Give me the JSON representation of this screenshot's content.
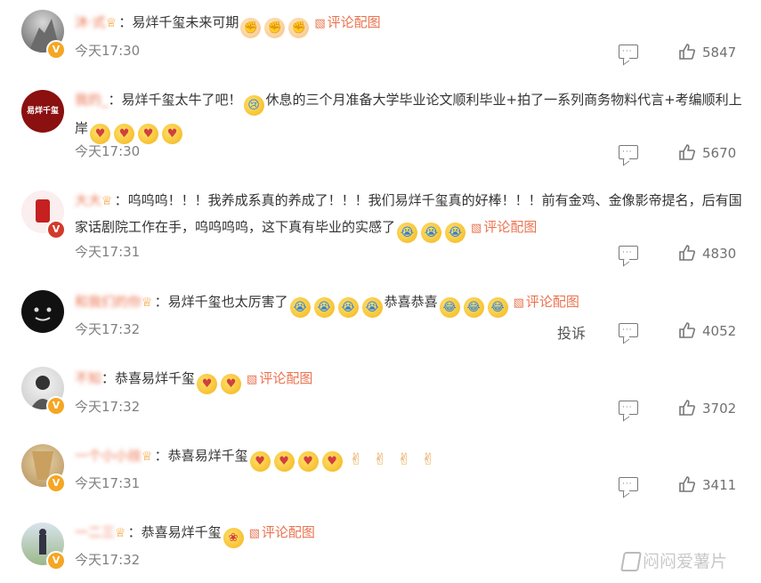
{
  "comments": [
    {
      "username": "沐·式",
      "badge": "♕",
      "content_parts": [
        {
          "type": "text",
          "value": "：易烊千玺未来可期"
        },
        {
          "type": "emoji",
          "name": "fist-emoji"
        },
        {
          "type": "emoji",
          "name": "fist-emoji"
        },
        {
          "type": "emoji",
          "name": "fist-emoji"
        }
      ],
      "link_label": "评论配图",
      "time": "今天17:30",
      "likes": "5847"
    },
    {
      "username": "我的_",
      "content_parts": [
        {
          "type": "text",
          "value": "：易烊千玺太牛了吧！"
        },
        {
          "type": "emoji",
          "name": "cry-emoji"
        },
        {
          "type": "text",
          "value": "休息的三个月准备大学毕业论文顺利毕业+拍了一系列商务物料代言+考编顺利上岸"
        },
        {
          "type": "emoji",
          "name": "love-emoji"
        },
        {
          "type": "emoji",
          "name": "love-emoji"
        },
        {
          "type": "emoji",
          "name": "love-emoji"
        },
        {
          "type": "emoji",
          "name": "love-emoji"
        }
      ],
      "avatar_text_top": "易烊千玺",
      "time": "今天17:30",
      "likes": "5670"
    },
    {
      "username": "大大",
      "badge": "♕",
      "content_parts": [
        {
          "type": "text",
          "value": "：呜呜呜！！！我养成系真的养成了！！！我们易烊千玺真的好棒！！！前有金鸡、金像影帝提名，后有国家话剧院工作在手，呜呜呜呜，这下真有毕业的实感了"
        },
        {
          "type": "emoji",
          "name": "cry-emoji"
        },
        {
          "type": "emoji",
          "name": "cry-emoji"
        },
        {
          "type": "emoji",
          "name": "cry-emoji"
        }
      ],
      "link_label": "评论配图",
      "time": "今天17:31",
      "likes": "4830"
    },
    {
      "username": "和我们的你",
      "badge": "♕",
      "content_parts": [
        {
          "type": "text",
          "value": "：易烊千玺也太厉害了"
        },
        {
          "type": "emoji",
          "name": "cry-emoji"
        },
        {
          "type": "emoji",
          "name": "cry-emoji"
        },
        {
          "type": "emoji",
          "name": "cry-emoji"
        },
        {
          "type": "emoji",
          "name": "cry-emoji"
        },
        {
          "type": "text",
          "value": "恭喜恭喜"
        },
        {
          "type": "emoji",
          "name": "tears-emoji"
        },
        {
          "type": "emoji",
          "name": "tears-emoji"
        },
        {
          "type": "emoji",
          "name": "tears-emoji"
        }
      ],
      "link_label": "评论配图",
      "time": "今天17:32",
      "report_label": "投诉",
      "likes": "4052"
    },
    {
      "username": "不知",
      "content_parts": [
        {
          "type": "text",
          "value": "：恭喜易烊千玺"
        },
        {
          "type": "emoji",
          "name": "love-emoji"
        },
        {
          "type": "emoji",
          "name": "love-emoji"
        }
      ],
      "link_label": "评论配图",
      "time": "今天17:32",
      "likes": "3702"
    },
    {
      "username": "一个小小技",
      "badge": "♕",
      "content_parts": [
        {
          "type": "text",
          "value": "：恭喜易烊千玺"
        },
        {
          "type": "emoji",
          "name": "love-emoji"
        },
        {
          "type": "emoji",
          "name": "love-emoji"
        },
        {
          "type": "emoji",
          "name": "love-emoji"
        },
        {
          "type": "emoji",
          "name": "love-emoji"
        },
        {
          "type": "emoji",
          "name": "rock-hand-emoji"
        },
        {
          "type": "emoji",
          "name": "rock-hand-emoji"
        },
        {
          "type": "emoji",
          "name": "rock-hand-emoji"
        },
        {
          "type": "emoji",
          "name": "rock-hand-emoji"
        }
      ],
      "time": "今天17:31",
      "likes": "3411"
    },
    {
      "username": "一二三",
      "badge": "♕",
      "content_parts": [
        {
          "type": "text",
          "value": "：恭喜易烊千玺"
        },
        {
          "type": "emoji",
          "name": "hug-emoji"
        }
      ],
      "link_label": "评论配图",
      "time": "今天17:32",
      "likes": ""
    }
  ],
  "watermark": "闷闷爱薯片",
  "colors": {
    "accent": "#eb7350",
    "time": "#808080",
    "vip_badge": "#f5a623"
  }
}
